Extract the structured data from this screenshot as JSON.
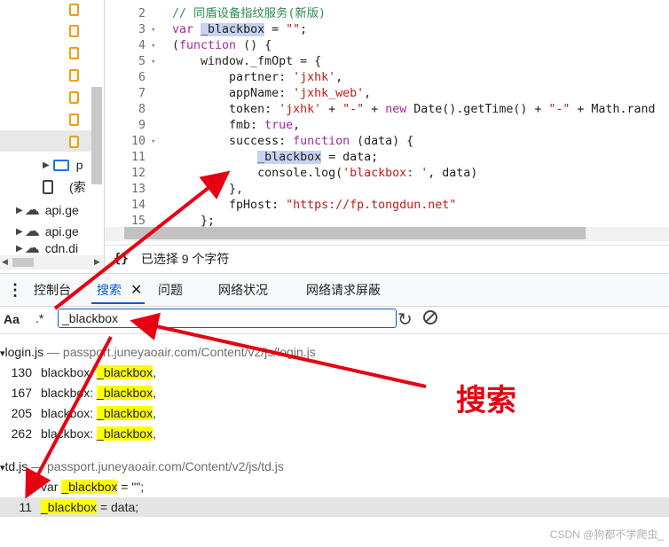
{
  "tree": {
    "folder_label": "p",
    "file_label": "(索",
    "domains": [
      "api.ge",
      "api.ge",
      "cdn.di"
    ]
  },
  "editor": {
    "lines": [
      {
        "n": "2",
        "fold": "",
        "parts": [
          [
            "c",
            "// 同盾设备指纹服务(新版)"
          ]
        ]
      },
      {
        "n": "3",
        "fold": "▾",
        "parts": [
          [
            "k",
            "var "
          ],
          [
            "hl",
            "_blackbox"
          ],
          [
            "p",
            " = "
          ],
          [
            "s",
            "\"\""
          ],
          [
            "p",
            ";"
          ]
        ]
      },
      {
        "n": "4",
        "fold": "▾",
        "parts": [
          [
            "p",
            "("
          ],
          [
            "k",
            "function"
          ],
          [
            "p",
            " () {"
          ]
        ]
      },
      {
        "n": "5",
        "fold": "▾",
        "parts": [
          [
            "p",
            "    window._fmOpt = {"
          ]
        ]
      },
      {
        "n": "6",
        "fold": "",
        "parts": [
          [
            "p",
            "        partner: "
          ],
          [
            "s",
            "'jxhk'"
          ],
          [
            "p",
            ","
          ]
        ]
      },
      {
        "n": "7",
        "fold": "",
        "parts": [
          [
            "p",
            "        appName: "
          ],
          [
            "s",
            "'jxhk_web'"
          ],
          [
            "p",
            ","
          ]
        ]
      },
      {
        "n": "8",
        "fold": "",
        "parts": [
          [
            "p",
            "        token: "
          ],
          [
            "s",
            "'jxhk'"
          ],
          [
            "p",
            " + "
          ],
          [
            "s",
            "\"-\""
          ],
          [
            "p",
            " + "
          ],
          [
            "k",
            "new"
          ],
          [
            "p",
            " Date().getTime() + "
          ],
          [
            "s",
            "\"-\""
          ],
          [
            "p",
            " + Math.rand"
          ]
        ]
      },
      {
        "n": "9",
        "fold": "",
        "parts": [
          [
            "p",
            "        fmb: "
          ],
          [
            "k",
            "true"
          ],
          [
            "p",
            ","
          ]
        ]
      },
      {
        "n": "10",
        "fold": "▾",
        "parts": [
          [
            "p",
            "        success: "
          ],
          [
            "k",
            "function"
          ],
          [
            "p",
            " (data) {"
          ]
        ]
      },
      {
        "n": "11",
        "fold": "",
        "parts": [
          [
            "p",
            "            "
          ],
          [
            "hl",
            "_blackbox"
          ],
          [
            "p",
            " = data;"
          ]
        ]
      },
      {
        "n": "12",
        "fold": "",
        "parts": [
          [
            "p",
            "            console.log("
          ],
          [
            "s",
            "'blackbox: '"
          ],
          [
            "p",
            ", data)"
          ]
        ]
      },
      {
        "n": "13",
        "fold": "",
        "parts": [
          [
            "p",
            "        },"
          ]
        ]
      },
      {
        "n": "14",
        "fold": "",
        "parts": [
          [
            "p",
            "        fpHost: "
          ],
          [
            "s",
            "\"https://fp.tongdun.net\""
          ]
        ]
      },
      {
        "n": "15",
        "fold": "",
        "parts": [
          [
            "p",
            "    };"
          ]
        ]
      }
    ]
  },
  "status": {
    "braces_icon": "{}",
    "text": "已选择 9 个字符"
  },
  "drawer": {
    "tabs": [
      "控制台",
      "搜索",
      "问题",
      "网络状况",
      "网络请求屏蔽"
    ],
    "active_tab": "搜索"
  },
  "search": {
    "case_label": "Aa",
    "regex_label": ".*",
    "query": "_blackbox"
  },
  "results": [
    {
      "file": "login.js",
      "path": "passport.juneyaoair.com/Content/v2/js/login.js",
      "matches": [
        {
          "line": "130",
          "before": "blackbox: ",
          "match": "_blackbox",
          "after": ","
        },
        {
          "line": "167",
          "before": "blackbox: ",
          "match": "_blackbox",
          "after": ","
        },
        {
          "line": "205",
          "before": "blackbox: ",
          "match": "_blackbox",
          "after": ","
        },
        {
          "line": "262",
          "before": "blackbox: ",
          "match": "_blackbox",
          "after": ","
        }
      ]
    },
    {
      "file": "td.js",
      "path": "passport.juneyaoair.com/Content/v2/js/td.js",
      "matches": [
        {
          "line": "3",
          "before": "var ",
          "match": "_blackbox",
          "after": " = \"\";"
        },
        {
          "line": "11",
          "before": "",
          "match": "_blackbox",
          "after": " = data;"
        }
      ]
    }
  ],
  "annotation": "搜索",
  "watermark": "CSDN @狗都不学爬虫_",
  "colors": {
    "accent": "#0b57d0",
    "highlight": "#ffff00",
    "arrow": "#e60012"
  }
}
